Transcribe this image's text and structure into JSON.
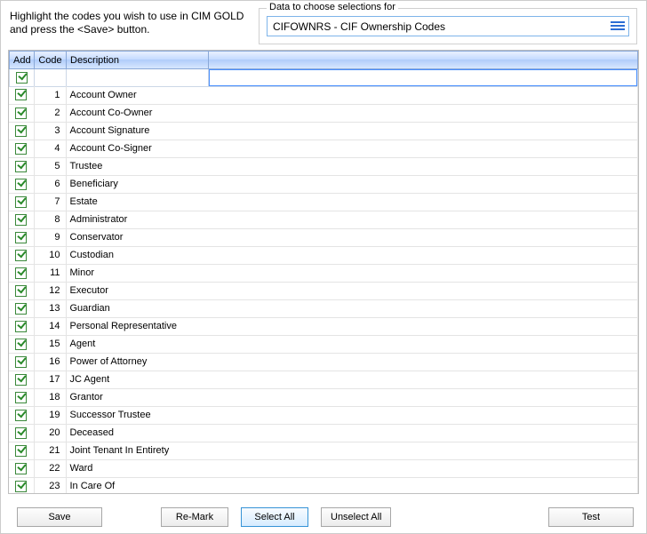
{
  "instructions": "Highlight the codes you wish to use in CIM GOLD and press the <Save> button.",
  "data_panel": {
    "label": "Data to choose selections for",
    "selected": "CIFOWNRS - CIF Ownership Codes"
  },
  "columns": {
    "add": "Add",
    "code": "Code",
    "description": "Description"
  },
  "rows": [
    {
      "checked": true,
      "code": "1",
      "description": "Account Owner"
    },
    {
      "checked": true,
      "code": "2",
      "description": "Account Co-Owner"
    },
    {
      "checked": true,
      "code": "3",
      "description": "Account Signature"
    },
    {
      "checked": true,
      "code": "4",
      "description": "Account Co-Signer"
    },
    {
      "checked": true,
      "code": "5",
      "description": "Trustee"
    },
    {
      "checked": true,
      "code": "6",
      "description": "Beneficiary"
    },
    {
      "checked": true,
      "code": "7",
      "description": "Estate"
    },
    {
      "checked": true,
      "code": "8",
      "description": "Administrator"
    },
    {
      "checked": true,
      "code": "9",
      "description": "Conservator"
    },
    {
      "checked": true,
      "code": "10",
      "description": "Custodian"
    },
    {
      "checked": true,
      "code": "11",
      "description": "Minor"
    },
    {
      "checked": true,
      "code": "12",
      "description": "Executor"
    },
    {
      "checked": true,
      "code": "13",
      "description": "Guardian"
    },
    {
      "checked": true,
      "code": "14",
      "description": "Personal Representative"
    },
    {
      "checked": true,
      "code": "15",
      "description": "Agent"
    },
    {
      "checked": true,
      "code": "16",
      "description": "Power of Attorney"
    },
    {
      "checked": true,
      "code": "17",
      "description": "JC Agent"
    },
    {
      "checked": true,
      "code": "18",
      "description": "Grantor"
    },
    {
      "checked": true,
      "code": "19",
      "description": "Successor Trustee"
    },
    {
      "checked": true,
      "code": "20",
      "description": "Deceased"
    },
    {
      "checked": true,
      "code": "21",
      "description": "Joint Tenant In Entirety"
    },
    {
      "checked": true,
      "code": "22",
      "description": "Ward"
    },
    {
      "checked": true,
      "code": "23",
      "description": "In Care Of"
    }
  ],
  "buttons": {
    "save": "Save",
    "remark": "Re-Mark",
    "select_all": "Select All",
    "unselect_all": "Unselect All",
    "test": "Test"
  }
}
